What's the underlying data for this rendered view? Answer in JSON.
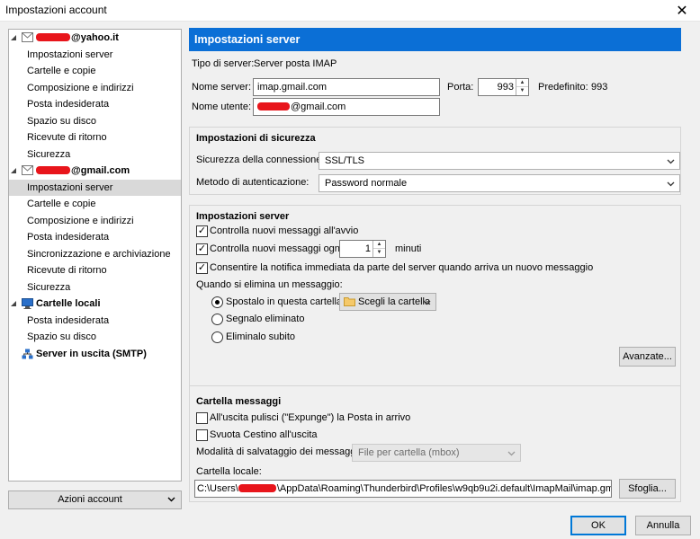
{
  "window": {
    "title": "Impostazioni account",
    "close_glyph": "✕"
  },
  "sidebar": {
    "accounts": [
      {
        "email_suffix": "@yahoo.it",
        "items": [
          "Impostazioni server",
          "Cartelle e copie",
          "Composizione e indirizzi",
          "Posta indesiderata",
          "Spazio su disco",
          "Ricevute di ritorno",
          "Sicurezza"
        ]
      },
      {
        "email_suffix": "@gmail.com",
        "items": [
          "Impostazioni server",
          "Cartelle e copie",
          "Composizione e indirizzi",
          "Posta indesiderata",
          "Sincronizzazione e archiviazione",
          "Ricevute di ritorno",
          "Sicurezza"
        ]
      },
      {
        "name": "Cartelle locali",
        "items": [
          "Posta indesiderata",
          "Spazio su disco"
        ]
      },
      {
        "name": "Server in uscita (SMTP)"
      }
    ],
    "selected": "gmail-impostazioni-server",
    "actions_label": "Azioni account"
  },
  "main": {
    "header": "Impostazioni server",
    "server_type_label": "Tipo di server:",
    "server_type_value": "Server posta IMAP",
    "server_name_label": "Nome server:",
    "server_name_value": "imap.gmail.com",
    "port_label": "Porta:",
    "port_value": "993",
    "default_label": "Predefinito:",
    "default_value": "993",
    "username_label": "Nome utente:",
    "username_suffix": "@gmail.com",
    "security": {
      "title": "Impostazioni di sicurezza",
      "connection_label": "Sicurezza della connessione:",
      "connection_value": "SSL/TLS",
      "auth_label": "Metodo di autenticazione:",
      "auth_value": "Password normale"
    },
    "server_settings": {
      "title": "Impostazioni server",
      "check_startup": "Controlla nuovi messaggi all'avvio",
      "check_every": "Controlla nuovi messaggi ogni",
      "check_every_value": "1",
      "minutes": "minuti",
      "allow_push": "Consentire la notifica immediata da parte del server quando arriva un nuovo messaggio",
      "on_delete_label": "Quando si elimina un messaggio:",
      "move_to_folder": "Spostalo in questa cartella:",
      "choose_folder": "Scegli la cartella",
      "mark_deleted": "Segnalo eliminato",
      "delete_now": "Eliminalo subito",
      "advanced_button": "Avanzate..."
    },
    "message_folder": {
      "title": "Cartella messaggi",
      "expunge": "All'uscita pulisci (\"Expunge\") la Posta in arrivo",
      "empty_trash": "Svuota Cestino all'uscita",
      "storage_label": "Modalità di salvataggio dei messaggi:",
      "storage_value": "File per cartella (mbox)",
      "local_folder_label": "Cartella locale:",
      "local_path_prefix": "C:\\Users\\",
      "local_path_suffix": "\\AppData\\Roaming\\Thunderbird\\Profiles\\w9qb9u2i.default\\ImapMail\\imap.gmail.cc",
      "browse_button": "Sfoglia..."
    }
  },
  "footer": {
    "ok": "OK",
    "cancel": "Annulla"
  },
  "colors": {
    "header_bg": "#0b6fd6",
    "redaction": "#e8151b",
    "selection": "#d9d9d9"
  }
}
